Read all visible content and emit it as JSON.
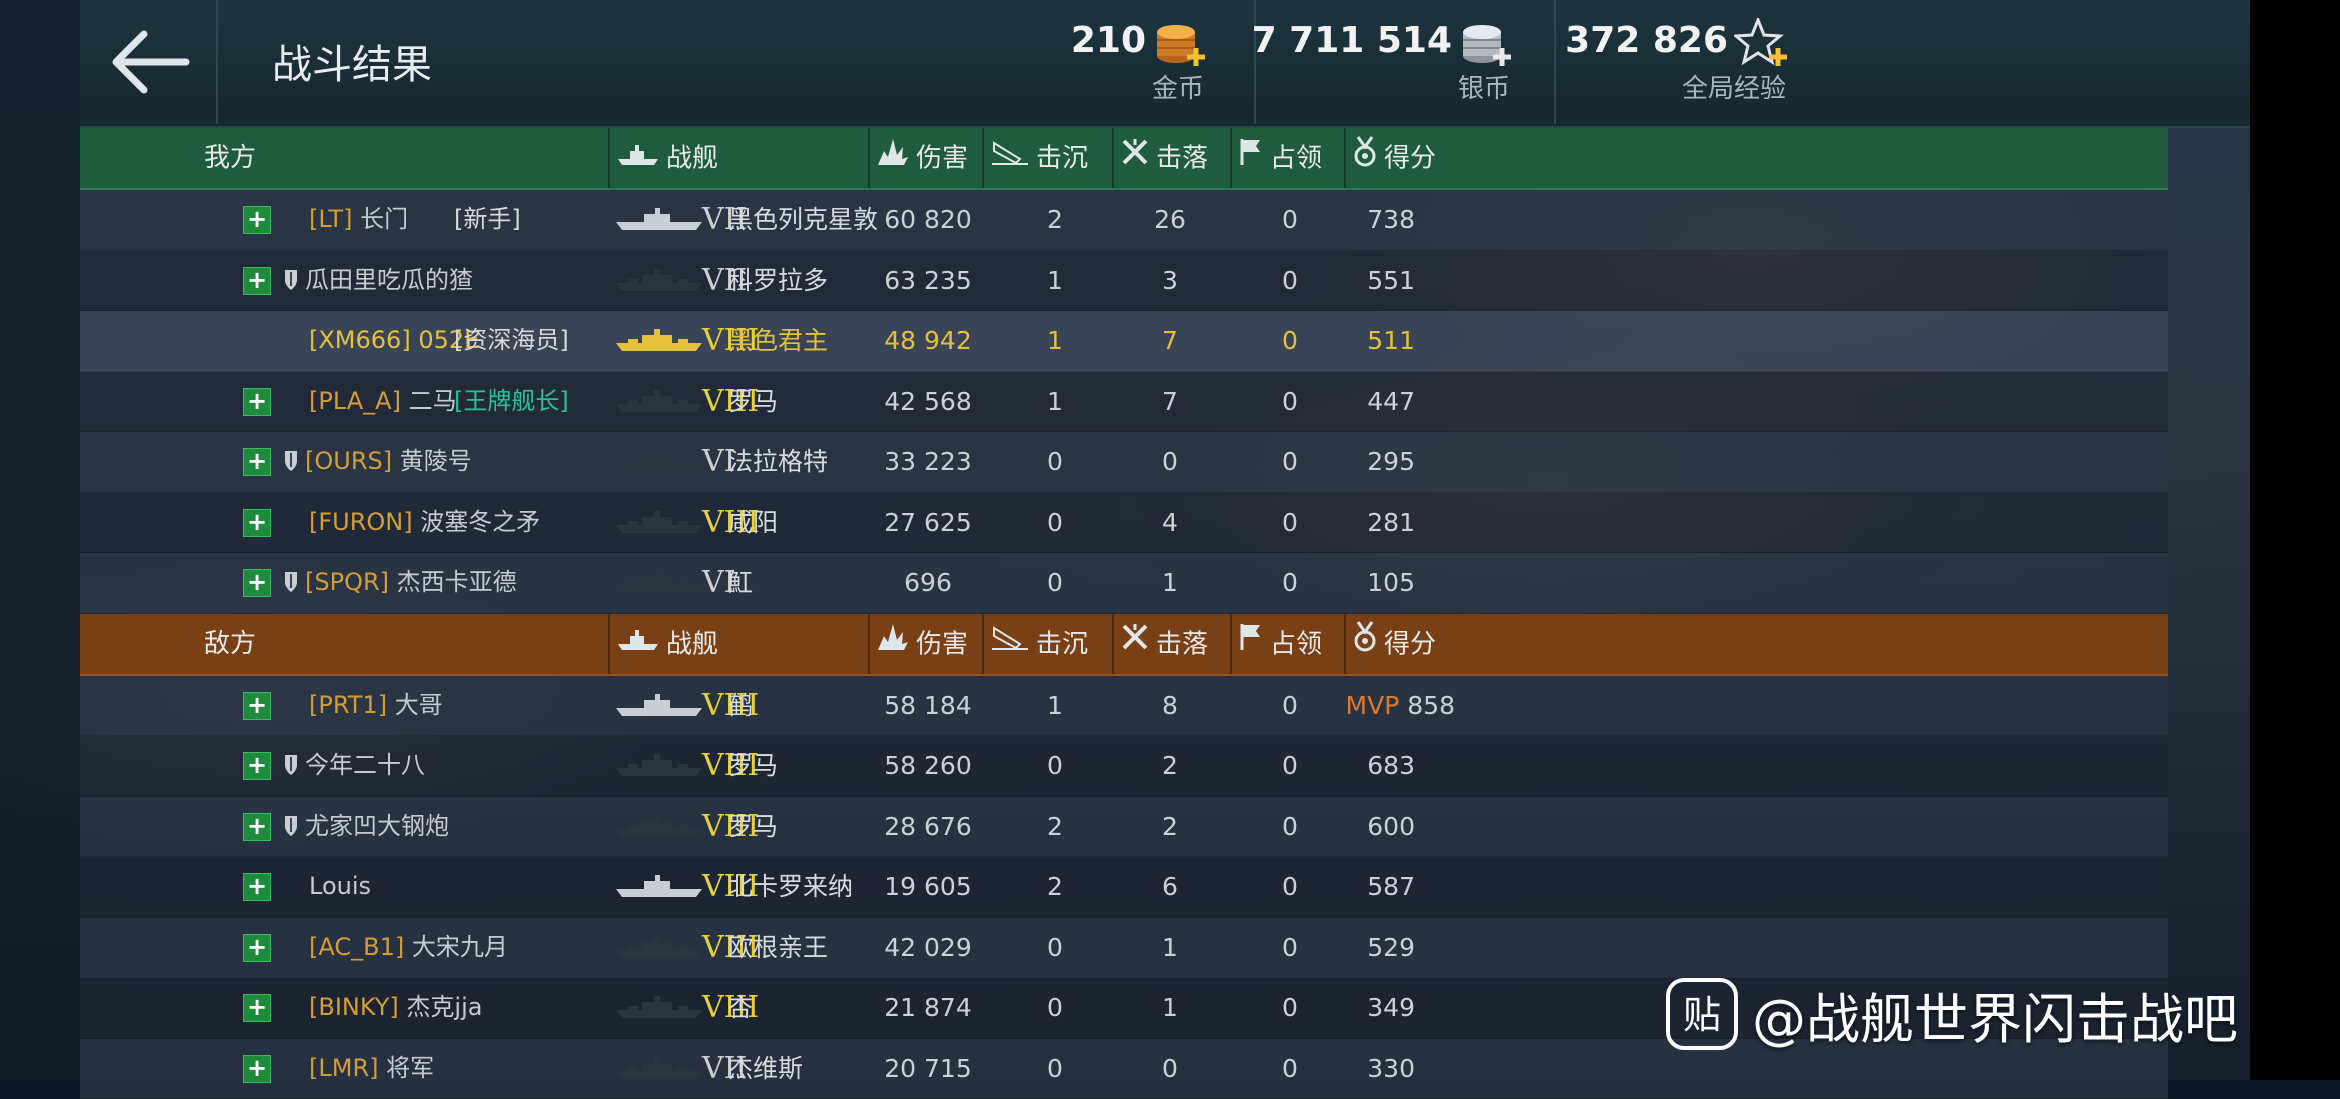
{
  "header": {
    "title": "战斗结果",
    "gold": {
      "amount": "210",
      "label": "金币"
    },
    "silver": {
      "amount": "7 711 514",
      "label": "银币"
    },
    "xp": {
      "amount": "372 826",
      "label": "全局经验"
    }
  },
  "columns": {
    "ship": "战舰",
    "damage": "伤害",
    "sunk": "击沉",
    "planes": "击落",
    "capture": "占领",
    "score": "得分"
  },
  "friendly": {
    "label": "我方",
    "rows": [
      {
        "tag": "[LT]",
        "name": "长门",
        "rank": "[新手]",
        "tier": "VII",
        "ship": "黑色列克星敦",
        "damage": "60 820",
        "sunk": "2",
        "planes": "26",
        "capture": "0",
        "score": "738",
        "plus": true,
        "shield": false
      },
      {
        "tag": "",
        "name": "瓜田里吃瓜的猹",
        "rank": "",
        "tier": "VII",
        "ship": "科罗拉多",
        "damage": "63 235",
        "sunk": "1",
        "planes": "3",
        "capture": "0",
        "score": "551",
        "plus": true,
        "shield": true
      },
      {
        "tag": "[XM666]",
        "name": "052E",
        "rank": "[资深海员]",
        "tier": "VIII",
        "ship": "黑色君主",
        "damage": "48 942",
        "sunk": "1",
        "planes": "7",
        "capture": "0",
        "score": "511",
        "plus": false,
        "shield": false,
        "self": true
      },
      {
        "tag": "[PLA_A]",
        "name": "二马",
        "rank": "[王牌舰长]",
        "tier": "VIII",
        "ship": "罗马",
        "damage": "42 568",
        "sunk": "1",
        "planes": "7",
        "capture": "0",
        "score": "447",
        "plus": true,
        "shield": false
      },
      {
        "tag": "[OURS]",
        "name": "黄陵号",
        "rank": "",
        "tier": "VI",
        "ship": "法拉格特",
        "damage": "33 223",
        "sunk": "0",
        "planes": "0",
        "capture": "0",
        "score": "295",
        "plus": true,
        "shield": true
      },
      {
        "tag": "[FURON]",
        "name": "波塞冬之矛",
        "rank": "",
        "tier": "VIII",
        "ship": "咸阳",
        "damage": "27 625",
        "sunk": "0",
        "planes": "4",
        "capture": "0",
        "score": "281",
        "plus": true,
        "shield": false
      },
      {
        "tag": "[SPQR]",
        "name": "杰西卡亚德",
        "rank": "",
        "tier": "VI",
        "ship": "魟",
        "damage": "696",
        "sunk": "0",
        "planes": "1",
        "capture": "0",
        "score": "105",
        "plus": true,
        "shield": true
      }
    ]
  },
  "enemy": {
    "label": "敌方",
    "rows": [
      {
        "tag": "[PRT1]",
        "name": "大哥",
        "rank": "",
        "tier": "VIII",
        "ship": "鹤",
        "damage": "58 184",
        "sunk": "1",
        "planes": "8",
        "capture": "0",
        "score": "858",
        "mvp": "MVP",
        "plus": true,
        "shield": false
      },
      {
        "tag": "",
        "name": "今年二十八",
        "rank": "",
        "tier": "VIII",
        "ship": "罗马",
        "damage": "58 260",
        "sunk": "0",
        "planes": "2",
        "capture": "0",
        "score": "683",
        "plus": true,
        "shield": true
      },
      {
        "tag": "",
        "name": "尤家凹大钢炮",
        "rank": "",
        "tier": "VIII",
        "ship": "罗马",
        "damage": "28 676",
        "sunk": "2",
        "planes": "2",
        "capture": "0",
        "score": "600",
        "plus": true,
        "shield": true
      },
      {
        "tag": "",
        "name": "Louis",
        "rank": "",
        "tier": "VIII",
        "ship": "北卡罗来纳",
        "damage": "19 605",
        "sunk": "2",
        "planes": "6",
        "capture": "0",
        "score": "587",
        "plus": true,
        "shield": false
      },
      {
        "tag": "[AC_B1]",
        "name": "大宋九月",
        "rank": "",
        "tier": "VIII",
        "ship": "欧根亲王",
        "damage": "42 029",
        "sunk": "0",
        "planes": "1",
        "capture": "0",
        "score": "529",
        "plus": true,
        "shield": false
      },
      {
        "tag": "[BINKY]",
        "name": "杰克jja",
        "rank": "",
        "tier": "VIII",
        "ship": "杏",
        "damage": "21 874",
        "sunk": "0",
        "planes": "1",
        "capture": "0",
        "score": "349",
        "plus": true,
        "shield": false
      },
      {
        "tag": "[LMR]",
        "name": "将军",
        "rank": "",
        "tier": "VII",
        "ship": "杰维斯",
        "damage": "20 715",
        "sunk": "0",
        "planes": "0",
        "capture": "0",
        "score": "330",
        "plus": true,
        "shield": false
      }
    ]
  },
  "watermark": {
    "text": "@战舰世界闪击战吧",
    "icon": "tieba-icon"
  },
  "colors": {
    "friendly_header": "#1f5b3d",
    "enemy_header": "#7a4015",
    "clan_tag": "#d49d38",
    "self_highlight": "#e5c13b",
    "mvp": "#e0782b",
    "gold_tier": "#e7d13a"
  }
}
